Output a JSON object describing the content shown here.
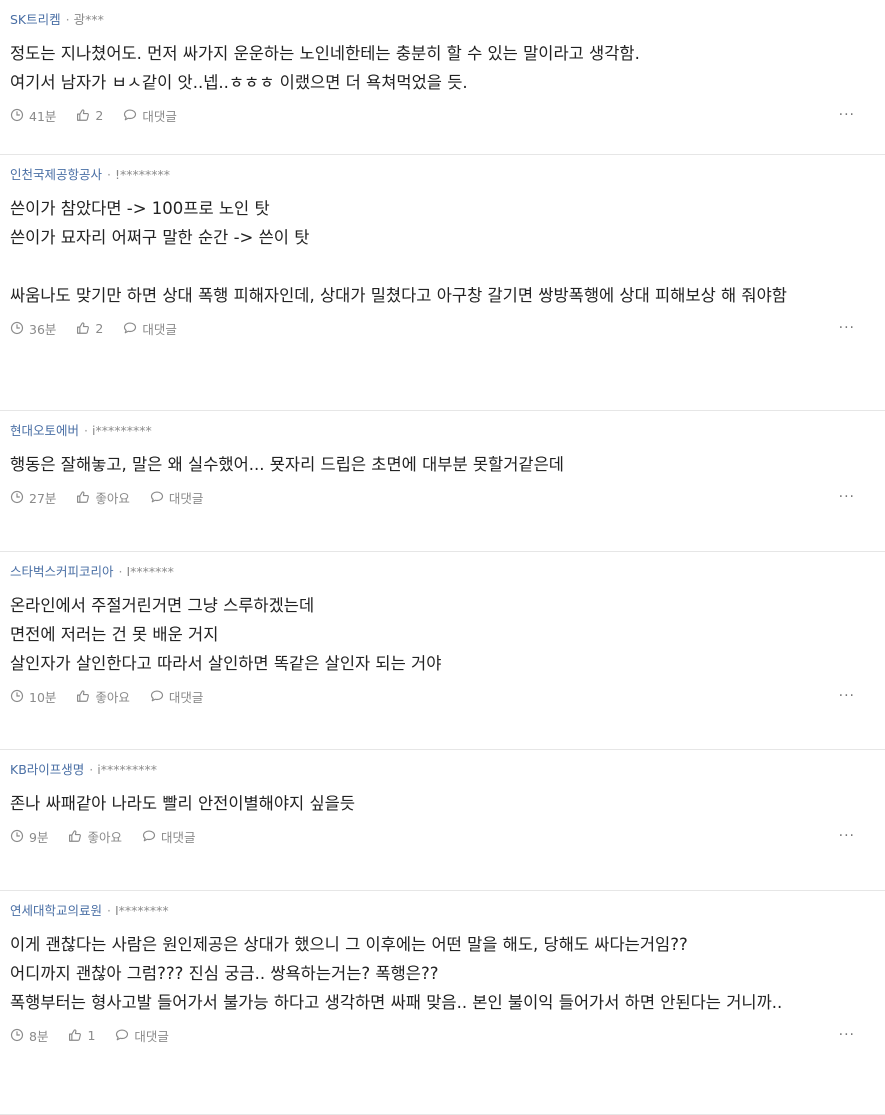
{
  "labels": {
    "reply": "대댓글",
    "more": "···"
  },
  "comments": [
    {
      "company": "SK트리켐",
      "author": "광***",
      "lines": [
        "정도는 지나쳤어도. 먼저 싸가지 운운하는 노인네한테는 충분히 할 수 있는 말이라고 생각함.",
        "여기서 남자가 ㅂㅅ같이 앗..넵..ㅎㅎㅎ 이랬으면 더 욕쳐먹었을 듯."
      ],
      "time": "41분",
      "likes": "2"
    },
    {
      "company": "인천국제공항공사",
      "author": "!********",
      "lines": [
        "쓴이가 참았다면 -> 100프로 노인 탓",
        "쓴이가 묘자리 어쩌구 말한 순간 -> 쓴이 탓",
        "",
        "싸움나도 맞기만 하면 상대 폭행 피해자인데, 상대가 밀쳤다고 아구창 갈기면 쌍방폭행에 상대 피해보상 해 줘야함"
      ],
      "time": "36분",
      "likes": "2"
    },
    {
      "company": "현대오토에버",
      "author": "i*********",
      "lines": [
        "행동은 잘해놓고, 말은 왜 실수했어... 묫자리 드립은 초면에 대부분 못할거같은데"
      ],
      "time": "27분",
      "likes": "좋아요"
    },
    {
      "company": "스타벅스커피코리아",
      "author": "I*******",
      "lines": [
        "온라인에서 주절거린거면 그냥 스루하겠는데",
        "면전에 저러는 건 못 배운 거지",
        "살인자가 살인한다고 따라서 살인하면 똑같은 살인자 되는 거야"
      ],
      "time": "10분",
      "likes": "좋아요"
    },
    {
      "company": "KB라이프생명",
      "author": "i*********",
      "lines": [
        "존나 싸패같아 나라도 빨리 안전이별해야지 싶을듯"
      ],
      "time": "9분",
      "likes": "좋아요"
    },
    {
      "company": "연세대학교의료원",
      "author": "I********",
      "lines": [
        "이게 괜찮다는 사람은 원인제공은 상대가 했으니 그 이후에는 어떤 말을 해도, 당해도 싸다는거임??",
        "어디까지 괜찮아 그럼??? 진심 궁금.. 쌍욕하는거는? 폭행은??",
        "폭행부터는 형사고발 들어가서 불가능 하다고 생각하면 싸패 맞음.. 본인 불이익 들어가서 하면 안된다는 거니까.."
      ],
      "time": "8분",
      "likes": "1"
    }
  ]
}
